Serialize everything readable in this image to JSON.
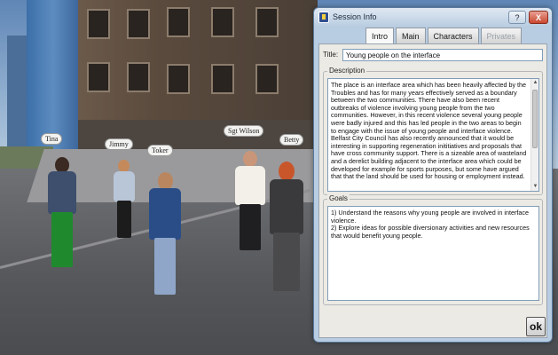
{
  "scene": {
    "nametags": [
      {
        "label": "Tina"
      },
      {
        "label": "Jimmy"
      },
      {
        "label": "Toker"
      },
      {
        "label": "Sgt Wilson"
      },
      {
        "label": "Betty"
      }
    ]
  },
  "dialog": {
    "title": "Session Info",
    "help_label": "?",
    "close_label": "X",
    "tabs": [
      {
        "label": "Intro"
      },
      {
        "label": "Main"
      },
      {
        "label": "Characters"
      },
      {
        "label": "Privates"
      }
    ],
    "title_field": {
      "label": "Title:",
      "value": "Young people on the interface"
    },
    "description": {
      "label": "Description",
      "text": "The place is an interface area which has been heavily affected by the Troubles and has for many years effectively served as a boundary between the two communities. There have also been recent outbreaks of violence involving young people from the two communities. However, in this recent violence several young people were badly injured and this has led people in the two areas to begin to engage with the issue of young people and interface violence. Belfast City Council has also recently announced that it would be interesting in supporting regeneration inititiatives and proposals that have cross community support. There is a sizeable area of wasteland and a derelict building adjacent to the interface area which could be developed for example for sports purposes, but some have argued that that the land should be used for housing or employment instead."
    },
    "goals": {
      "label": "Goals",
      "items": [
        "1) Understand the reasons why young people are involved in interface violence.",
        "2) Explore ideas for possible diversionary activities and new resources that would benefit young people."
      ]
    },
    "ok_label": "ok"
  }
}
